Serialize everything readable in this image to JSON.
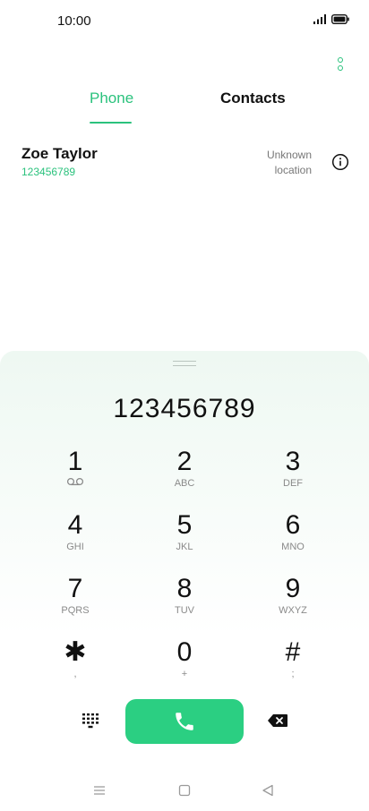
{
  "status_bar": {
    "time": "10:00"
  },
  "tabs": [
    {
      "label": "Phone",
      "active": true
    },
    {
      "label": "Contacts",
      "active": false
    }
  ],
  "call_log": [
    {
      "name": "Zoe Taylor",
      "number": "123456789",
      "location": "Unknown location"
    }
  ],
  "dialer": {
    "display_number": "123456789",
    "keys": [
      {
        "digit": "1",
        "sub": ""
      },
      {
        "digit": "2",
        "sub": "ABC"
      },
      {
        "digit": "3",
        "sub": "DEF"
      },
      {
        "digit": "4",
        "sub": "GHI"
      },
      {
        "digit": "5",
        "sub": "JKL"
      },
      {
        "digit": "6",
        "sub": "MNO"
      },
      {
        "digit": "7",
        "sub": "PQRS"
      },
      {
        "digit": "8",
        "sub": "TUV"
      },
      {
        "digit": "9",
        "sub": "WXYZ"
      },
      {
        "digit": "✱",
        "sub": ","
      },
      {
        "digit": "0",
        "sub": "+"
      },
      {
        "digit": "#",
        "sub": ";"
      }
    ]
  },
  "colors": {
    "accent": "#2bc27d",
    "call_button": "#2bcf82"
  },
  "icons": {
    "more": "more-options-icon",
    "info": "info-icon",
    "voicemail": "voicemail-icon",
    "keypad": "dialpad-icon",
    "call": "phone-icon",
    "backspace": "backspace-icon"
  }
}
